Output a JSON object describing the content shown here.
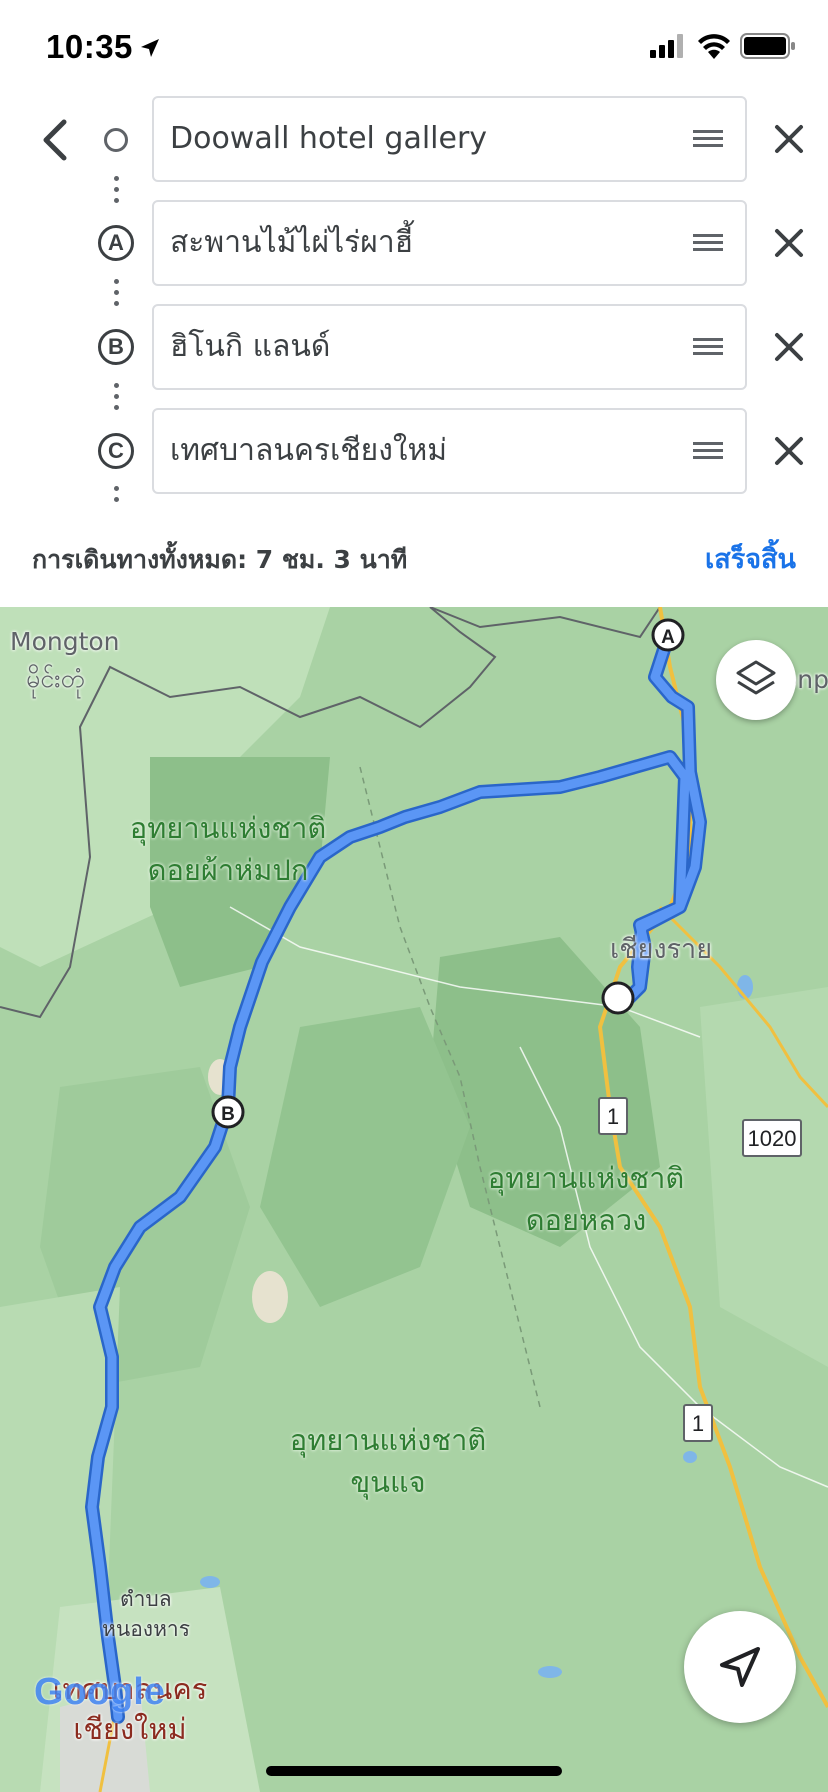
{
  "status_bar": {
    "time": "10:35"
  },
  "waypoints": [
    {
      "marker": "",
      "value": "Doowall hotel gallery"
    },
    {
      "marker": "A",
      "value": "สะพานไม้ไผ่ไร่ผาฮี้"
    },
    {
      "marker": "B",
      "value": "ฮิโนกิ แลนด์"
    },
    {
      "marker": "C",
      "value": "เทศบาลนครเชียงใหม่"
    }
  ],
  "summary": {
    "total_text": "การเดินทางทั้งหมด: 7 ชม. 3 นาที",
    "done_label": "เสร็จสิ้น"
  },
  "map": {
    "labels": {
      "mongton": "Mongton",
      "mongton_burmese": "မိုင်းတုံ",
      "park1_line1": "อุทยานแห่งชาติ",
      "park1_line2": "ดอยผ้าห่มปก",
      "chiang_rai": "เชียงราย",
      "park2_line1": "อุทยานแห่งชาติ",
      "park2_line2": "ดอยหลวง",
      "park3_line1": "อุทยานแห่งชาติ",
      "park3_line2": "ขุนแจ",
      "tambon": "ตำบล",
      "nong_han": "หนองหาร",
      "city_line1": "เทศบาลนคร",
      "city_line2": "เชียงใหม่",
      "edge_text": "onp",
      "watermark": "Google"
    },
    "route_markers": [
      "A",
      "B"
    ],
    "road_shields": [
      "1",
      "1020",
      "1"
    ],
    "colors": {
      "route": "#4285f4",
      "park": "#8fbf8c",
      "land": "#a8d0a5",
      "road": "#f0c040"
    }
  },
  "icons": {
    "back": "chevron-left-icon",
    "remove": "close-icon",
    "drag": "drag-handle-icon",
    "layers": "layers-icon",
    "navigate": "navigation-arrow-icon"
  }
}
